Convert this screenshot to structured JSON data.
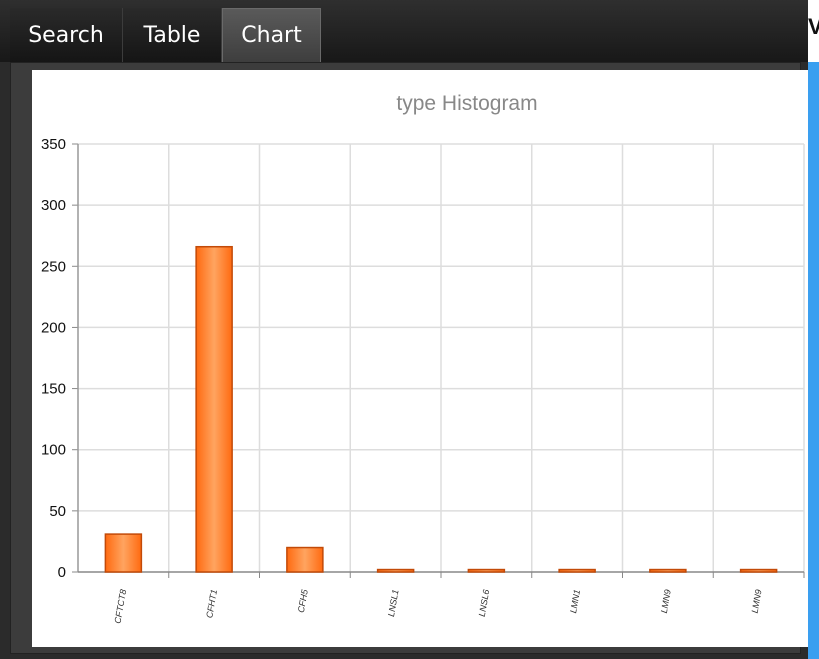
{
  "tabs": [
    {
      "label": "Search",
      "active": false
    },
    {
      "label": "Table",
      "active": false
    },
    {
      "label": "Chart",
      "active": true
    }
  ],
  "strip_text": "V",
  "bar_color": "#ff7b24",
  "chart_data": {
    "type": "bar",
    "title": "type Histogram",
    "xlabel": "",
    "ylabel": "",
    "ylim": [
      0,
      350
    ],
    "yticks": [
      0,
      50,
      100,
      150,
      200,
      250,
      300,
      350
    ],
    "grid": true,
    "categories": [
      "CFTCT8",
      "CFHT1",
      "CFH5",
      "LNSL1",
      "LNSL6",
      "LMN1",
      "LMN9",
      "LMN9"
    ],
    "values": [
      31,
      266,
      20,
      2,
      2,
      2,
      2,
      2
    ]
  }
}
